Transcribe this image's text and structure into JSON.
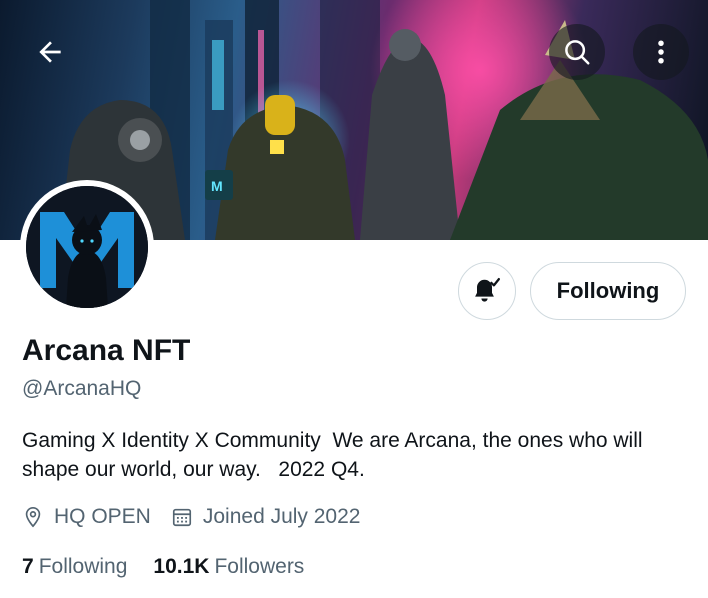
{
  "profile": {
    "name": "Arcana NFT",
    "handle": "@ArcanaHQ",
    "bio": "Gaming X Identity X Community  We are Arcana, the ones who will shape our world, our way.   2022 Q4.",
    "location": "HQ OPEN",
    "joined": "Joined July 2022"
  },
  "stats": {
    "following_count": "7",
    "following_label": "Following",
    "followers_count": "10.1K",
    "followers_label": "Followers"
  },
  "actions": {
    "follow_state_label": "Following"
  },
  "icons": {
    "back": "arrow-left-icon",
    "search": "search-icon",
    "more": "more-vertical-icon",
    "notify": "bell-check-icon",
    "location": "location-pin-icon",
    "calendar": "calendar-icon"
  },
  "colors": {
    "text_primary": "#0f1419",
    "text_secondary": "#536471",
    "border": "#cfd9de"
  }
}
